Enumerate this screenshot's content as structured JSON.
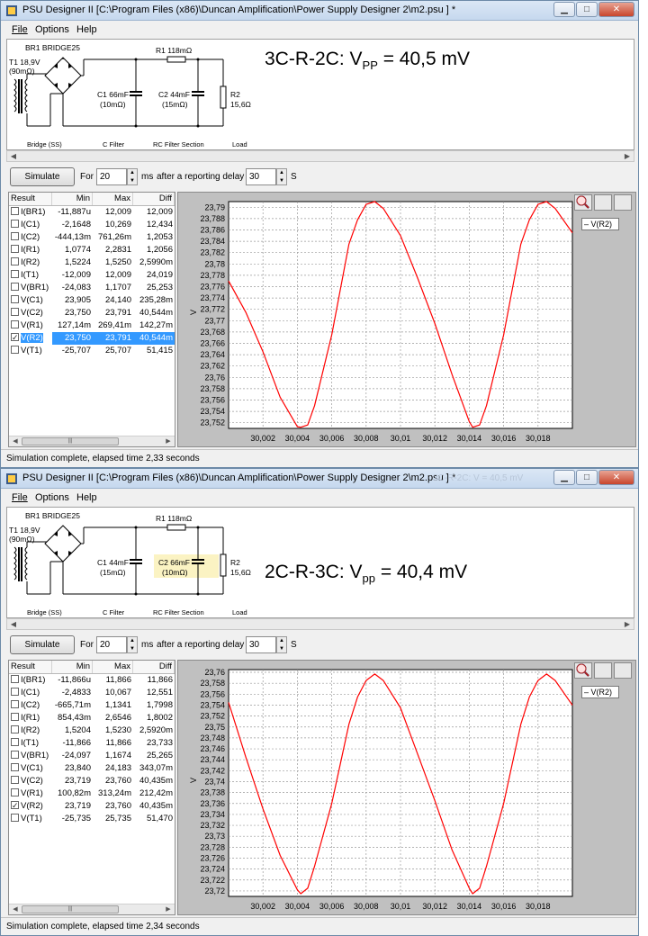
{
  "windows": [
    {
      "title": "PSU Designer II  [C:\\Program Files (x86)\\Duncan Amplification\\Power Supply Designer 2\\m2.psu ] *",
      "ghost_title": "",
      "menu": [
        "File",
        "Options",
        "Help"
      ],
      "schematic": {
        "transformer_label": "T1 18,9V",
        "transformer_res": "(90mΩ)",
        "bridge_label": "BR1 BRIDGE25",
        "r1_label": "R1 118mΩ",
        "c1_label": "C1 66mF",
        "c1_res": "(10mΩ)",
        "c2_label": "C2 44mF",
        "c2_res": "(15mΩ)",
        "r2_label": "R2",
        "r2_value": "15,6Ω",
        "sections": [
          "Bridge (SS)",
          "C Filter",
          "RC Filter Section",
          "Load"
        ],
        "highlight_c2": false
      },
      "annotation": {
        "main": "3C-R-2C: V",
        "sub": "PP",
        "tail": " = 40,5 mV"
      },
      "controls": {
        "simulate_label": "Simulate",
        "for_label": "For",
        "duration": "20",
        "ms_label": "ms",
        "delay_label": "after a reporting delay of",
        "delay": "30",
        "s_label": "S"
      },
      "table": {
        "headers": [
          "Result",
          "Min",
          "Max",
          "Diff"
        ],
        "rows": [
          {
            "label": "I(BR1)",
            "min": "-11,887u",
            "max": "12,009",
            "diff": "12,009",
            "checked": false,
            "selected": false
          },
          {
            "label": "I(C1)",
            "min": "-2,1648",
            "max": "10,269",
            "diff": "12,434",
            "checked": false,
            "selected": false
          },
          {
            "label": "I(C2)",
            "min": "-444,13m",
            "max": "761,26m",
            "diff": "1,2053",
            "checked": false,
            "selected": false
          },
          {
            "label": "I(R1)",
            "min": "1,0774",
            "max": "2,2831",
            "diff": "1,2056",
            "checked": false,
            "selected": false
          },
          {
            "label": "I(R2)",
            "min": "1,5224",
            "max": "1,5250",
            "diff": "2,5990m",
            "checked": false,
            "selected": false
          },
          {
            "label": "I(T1)",
            "min": "-12,009",
            "max": "12,009",
            "diff": "24,019",
            "checked": false,
            "selected": false
          },
          {
            "label": "V(BR1)",
            "min": "-24,083",
            "max": "1,1707",
            "diff": "25,253",
            "checked": false,
            "selected": false
          },
          {
            "label": "V(C1)",
            "min": "23,905",
            "max": "24,140",
            "diff": "235,28m",
            "checked": false,
            "selected": false
          },
          {
            "label": "V(C2)",
            "min": "23,750",
            "max": "23,791",
            "diff": "40,544m",
            "checked": false,
            "selected": false
          },
          {
            "label": "V(R1)",
            "min": "127,14m",
            "max": "269,41m",
            "diff": "142,27m",
            "checked": false,
            "selected": false
          },
          {
            "label": "V(R2)",
            "min": "23,750",
            "max": "23,791",
            "diff": "40,544m",
            "checked": true,
            "selected": true
          },
          {
            "label": "V(T1)",
            "min": "-25,707",
            "max": "25,707",
            "diff": "51,415",
            "checked": false,
            "selected": false
          }
        ]
      },
      "chart_data": {
        "type": "line",
        "ylabel": "V",
        "legend": "– V(R2)",
        "legend_position": "top-right",
        "grid": true,
        "line_color": "#ff0000",
        "xlim": [
          30.0,
          30.02
        ],
        "ylim": [
          23.751,
          23.791
        ],
        "x_ticks": [
          "30,002",
          "30,004",
          "30,006",
          "30,008",
          "30,01",
          "30,012",
          "30,014",
          "30,016",
          "30,018"
        ],
        "y_ticks": [
          "23,79",
          "23,788",
          "23,786",
          "23,784",
          "23,782",
          "23,78",
          "23,778",
          "23,776",
          "23,774",
          "23,772",
          "23,77",
          "23,768",
          "23,766",
          "23,764",
          "23,762",
          "23,76",
          "23,758",
          "23,756",
          "23,754",
          "23,752"
        ],
        "series": [
          {
            "name": "V(R2)",
            "x": [
              30.0,
              30.001,
              30.002,
              30.003,
              30.004,
              30.0042,
              30.0046,
              30.005,
              30.006,
              30.007,
              30.0075,
              30.008,
              30.0085,
              30.009,
              30.01,
              30.011,
              30.012,
              30.013,
              30.014,
              30.0142,
              30.0146,
              30.015,
              30.016,
              30.017,
              30.0175,
              30.018,
              30.0185,
              30.019,
              30.02
            ],
            "y": [
              23.777,
              23.7715,
              23.7645,
              23.7565,
              23.7513,
              23.7512,
              23.7516,
              23.755,
              23.7675,
              23.7835,
              23.7878,
              23.7905,
              23.791,
              23.7898,
              23.785,
              23.7775,
              23.7695,
              23.7605,
              23.7522,
              23.7512,
              23.7516,
              23.755,
              23.7675,
              23.7835,
              23.7878,
              23.7905,
              23.791,
              23.7898,
              23.7855
            ]
          }
        ]
      },
      "status": "Simulation complete, elapsed time 2,33 seconds"
    },
    {
      "title": "PSU Designer II  [C:\\Program Files (x86)\\Duncan Amplification\\Power Supply Designer 2\\m2.psu ] *",
      "ghost_title": "3C-R-2C: V  = 40,5 mV",
      "menu": [
        "File",
        "Options",
        "Help"
      ],
      "schematic": {
        "transformer_label": "T1 18,9V",
        "transformer_res": "(90mΩ)",
        "bridge_label": "BR1 BRIDGE25",
        "r1_label": "R1 118mΩ",
        "c1_label": "C1 44mF",
        "c1_res": "(15mΩ)",
        "c2_label": "C2 66mF",
        "c2_res": "(10mΩ)",
        "r2_label": "R2",
        "r2_value": "15,6Ω",
        "sections": [
          "Bridge (SS)",
          "C Filter",
          "RC Filter Section",
          "Load"
        ],
        "highlight_c2": true
      },
      "annotation": {
        "main": "2C-R-3C: V",
        "sub": "pp",
        "tail": " = 40,4 mV"
      },
      "controls": {
        "simulate_label": "Simulate",
        "for_label": "For",
        "duration": "20",
        "ms_label": "ms",
        "delay_label": "after a reporting delay of",
        "delay": "30",
        "s_label": "S"
      },
      "table": {
        "headers": [
          "Result",
          "Min",
          "Max",
          "Diff"
        ],
        "rows": [
          {
            "label": "I(BR1)",
            "min": "-11,866u",
            "max": "11,866",
            "diff": "11,866",
            "checked": false,
            "selected": false
          },
          {
            "label": "I(C1)",
            "min": "-2,4833",
            "max": "10,067",
            "diff": "12,551",
            "checked": false,
            "selected": false
          },
          {
            "label": "I(C2)",
            "min": "-665,71m",
            "max": "1,1341",
            "diff": "1,7998",
            "checked": false,
            "selected": false
          },
          {
            "label": "I(R1)",
            "min": "854,43m",
            "max": "2,6546",
            "diff": "1,8002",
            "checked": false,
            "selected": false
          },
          {
            "label": "I(R2)",
            "min": "1,5204",
            "max": "1,5230",
            "diff": "2,5920m",
            "checked": false,
            "selected": false
          },
          {
            "label": "I(T1)",
            "min": "-11,866",
            "max": "11,866",
            "diff": "23,733",
            "checked": false,
            "selected": false
          },
          {
            "label": "V(BR1)",
            "min": "-24,097",
            "max": "1,1674",
            "diff": "25,265",
            "checked": false,
            "selected": false
          },
          {
            "label": "V(C1)",
            "min": "23,840",
            "max": "24,183",
            "diff": "343,07m",
            "checked": false,
            "selected": false
          },
          {
            "label": "V(C2)",
            "min": "23,719",
            "max": "23,760",
            "diff": "40,435m",
            "checked": false,
            "selected": false
          },
          {
            "label": "V(R1)",
            "min": "100,82m",
            "max": "313,24m",
            "diff": "212,42m",
            "checked": false,
            "selected": false
          },
          {
            "label": "V(R2)",
            "min": "23,719",
            "max": "23,760",
            "diff": "40,435m",
            "checked": true,
            "selected": false
          },
          {
            "label": "V(T1)",
            "min": "-25,735",
            "max": "25,735",
            "diff": "51,470",
            "checked": false,
            "selected": false
          }
        ]
      },
      "chart_data": {
        "type": "line",
        "ylabel": "V",
        "legend": "– V(R2)",
        "legend_position": "top-right",
        "grid": true,
        "line_color": "#ff0000",
        "xlim": [
          30.0,
          30.02
        ],
        "ylim": [
          23.719,
          23.7605
        ],
        "x_ticks": [
          "30,002",
          "30,004",
          "30,006",
          "30,008",
          "30,01",
          "30,012",
          "30,014",
          "30,016",
          "30,018"
        ],
        "y_ticks": [
          "23,76",
          "23,758",
          "23,756",
          "23,754",
          "23,752",
          "23,75",
          "23,748",
          "23,746",
          "23,744",
          "23,742",
          "23,74",
          "23,738",
          "23,736",
          "23,734",
          "23,732",
          "23,73",
          "23,728",
          "23,726",
          "23,724",
          "23,722",
          "23,72"
        ],
        "series": [
          {
            "name": "V(R2)",
            "x": [
              30.0,
              30.001,
              30.002,
              30.003,
              30.004,
              30.0042,
              30.0046,
              30.005,
              30.006,
              30.007,
              30.0075,
              30.008,
              30.0085,
              30.009,
              30.01,
              30.011,
              30.012,
              30.013,
              30.014,
              30.0142,
              30.0146,
              30.015,
              30.016,
              30.017,
              30.0175,
              30.018,
              30.0185,
              30.019,
              30.02
            ],
            "y": [
              23.7545,
              23.7445,
              23.735,
              23.7265,
              23.7202,
              23.7195,
              23.7205,
              23.7245,
              23.736,
              23.7505,
              23.7555,
              23.7585,
              23.7597,
              23.7585,
              23.7535,
              23.745,
              23.7365,
              23.7275,
              23.7205,
              23.7195,
              23.7205,
              23.7245,
              23.736,
              23.7505,
              23.7555,
              23.7585,
              23.7597,
              23.7585,
              23.754
            ]
          }
        ]
      },
      "status": "Simulation complete, elapsed time 2,34 seconds"
    }
  ]
}
